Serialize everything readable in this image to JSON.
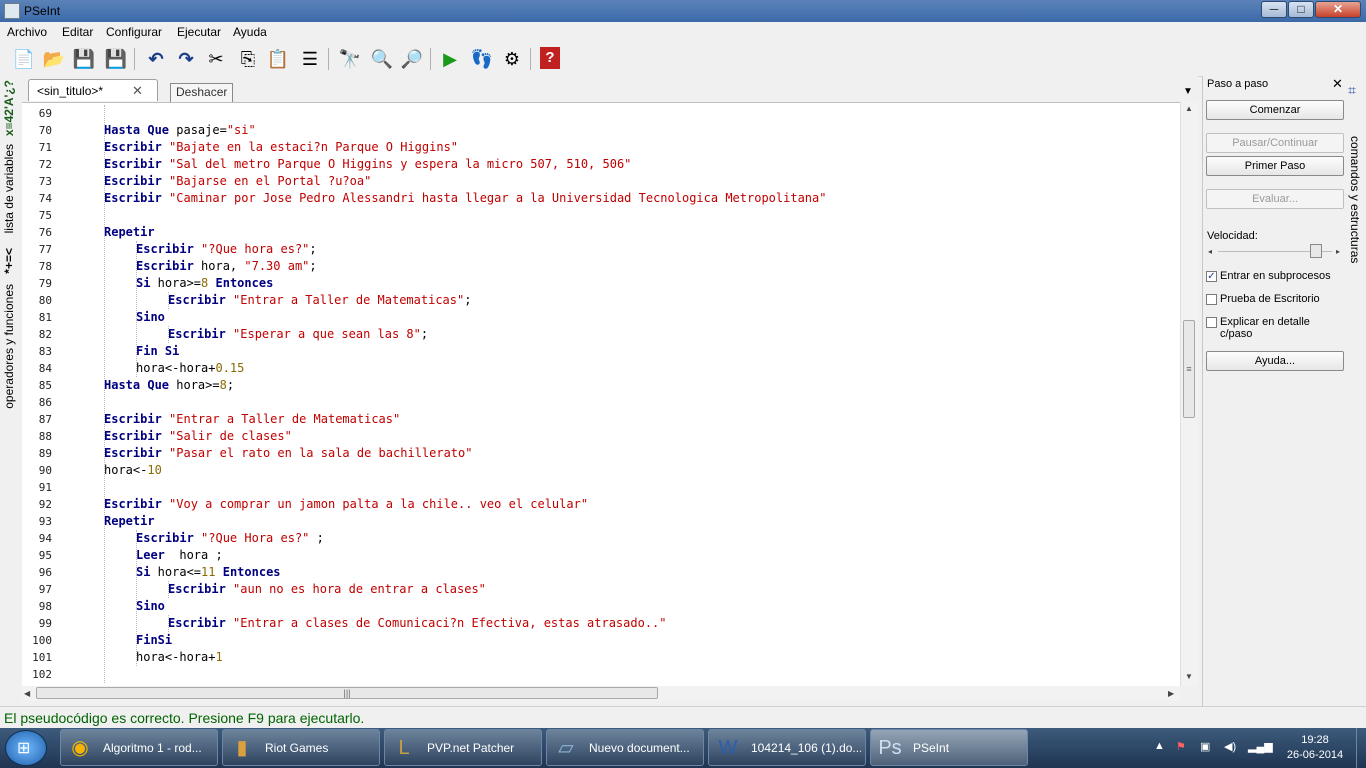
{
  "window": {
    "title": "PSeInt",
    "min": "─",
    "max": "□",
    "close": "✕"
  },
  "menu": [
    "Archivo",
    "Editar",
    "Configurar",
    "Ejecutar",
    "Ayuda"
  ],
  "toolbar_icons": [
    {
      "name": "new-file-icon",
      "glyph": "📄"
    },
    {
      "name": "open-file-icon",
      "glyph": "📂"
    },
    {
      "name": "save-icon",
      "glyph": "💾"
    },
    {
      "name": "save-as-icon",
      "glyph": "💾"
    },
    {
      "name": "undo-icon",
      "glyph": "↶"
    },
    {
      "name": "redo-icon",
      "glyph": "↷"
    },
    {
      "name": "cut-icon",
      "glyph": "✂"
    },
    {
      "name": "copy-icon",
      "glyph": "⎘"
    },
    {
      "name": "paste-icon",
      "glyph": "📋"
    },
    {
      "name": "indent-icon",
      "glyph": "☰"
    },
    {
      "name": "find-icon",
      "glyph": "🔭"
    },
    {
      "name": "find-previous-icon",
      "glyph": "🔍"
    },
    {
      "name": "find-next-icon",
      "glyph": "🔎"
    },
    {
      "name": "run-icon",
      "glyph": "▶"
    },
    {
      "name": "step-by-step-icon",
      "glyph": "👣"
    },
    {
      "name": "flowchart-icon",
      "glyph": "⚙"
    },
    {
      "name": "help-icon",
      "glyph": "?"
    }
  ],
  "left_panel": {
    "variables_label": "lista de variables",
    "variables_symbols": "*+=<",
    "operators_label": "operadores y funciones",
    "operators_symbols": "x≡42'A'¿?"
  },
  "tab": {
    "label": "<sin_titulo>*",
    "close": "✕"
  },
  "tooltip": "Deshacer",
  "code_lines": [
    {
      "n": "69",
      "indent": 0,
      "tokens": []
    },
    {
      "n": "70",
      "indent": 1,
      "tokens": [
        {
          "t": "Hasta Que",
          "c": "kw"
        },
        {
          "t": " pasaje=",
          "c": ""
        },
        {
          "t": "\"si\"",
          "c": "str"
        }
      ]
    },
    {
      "n": "71",
      "indent": 1,
      "tokens": [
        {
          "t": "Escribir",
          "c": "kw"
        },
        {
          "t": " ",
          "c": ""
        },
        {
          "t": "\"Bajate en la estaci?n Parque O Higgins\"",
          "c": "str"
        }
      ]
    },
    {
      "n": "72",
      "indent": 1,
      "tokens": [
        {
          "t": "Escribir",
          "c": "kw"
        },
        {
          "t": " ",
          "c": ""
        },
        {
          "t": "\"Sal del metro Parque O Higgins y espera la micro 507, 510, 506\"",
          "c": "str"
        }
      ]
    },
    {
      "n": "73",
      "indent": 1,
      "tokens": [
        {
          "t": "Escribir",
          "c": "kw"
        },
        {
          "t": " ",
          "c": ""
        },
        {
          "t": "\"Bajarse en el Portal ?u?oa\"",
          "c": "str"
        }
      ]
    },
    {
      "n": "74",
      "indent": 1,
      "tokens": [
        {
          "t": "Escribir",
          "c": "kw"
        },
        {
          "t": " ",
          "c": ""
        },
        {
          "t": "\"Caminar por Jose Pedro Alessandri hasta llegar a la Universidad Tecnologica Metropolitana\"",
          "c": "str"
        }
      ]
    },
    {
      "n": "75",
      "indent": 1,
      "tokens": []
    },
    {
      "n": "76",
      "indent": 1,
      "tokens": [
        {
          "t": "Repetir",
          "c": "kw"
        }
      ]
    },
    {
      "n": "77",
      "indent": 2,
      "tokens": [
        {
          "t": "Escribir",
          "c": "kw"
        },
        {
          "t": " ",
          "c": ""
        },
        {
          "t": "\"?Que hora es?\"",
          "c": "str"
        },
        {
          "t": ";",
          "c": ""
        }
      ]
    },
    {
      "n": "78",
      "indent": 2,
      "tokens": [
        {
          "t": "Escribir",
          "c": "kw"
        },
        {
          "t": " hora, ",
          "c": ""
        },
        {
          "t": "\"7.30 am\"",
          "c": "str"
        },
        {
          "t": ";",
          "c": ""
        }
      ]
    },
    {
      "n": "79",
      "indent": 2,
      "tokens": [
        {
          "t": "Si",
          "c": "kw"
        },
        {
          "t": " hora>=",
          "c": ""
        },
        {
          "t": "8",
          "c": "num"
        },
        {
          "t": " ",
          "c": ""
        },
        {
          "t": "Entonces",
          "c": "kw"
        }
      ]
    },
    {
      "n": "80",
      "indent": 3,
      "tokens": [
        {
          "t": "Escribir",
          "c": "kw"
        },
        {
          "t": " ",
          "c": ""
        },
        {
          "t": "\"Entrar a Taller de Matematicas\"",
          "c": "str"
        },
        {
          "t": ";",
          "c": ""
        }
      ]
    },
    {
      "n": "81",
      "indent": 2,
      "tokens": [
        {
          "t": "Sino",
          "c": "kw"
        }
      ]
    },
    {
      "n": "82",
      "indent": 3,
      "tokens": [
        {
          "t": "Escribir",
          "c": "kw"
        },
        {
          "t": " ",
          "c": ""
        },
        {
          "t": "\"Esperar a que sean las 8\"",
          "c": "str"
        },
        {
          "t": ";",
          "c": ""
        }
      ]
    },
    {
      "n": "83",
      "indent": 2,
      "tokens": [
        {
          "t": "Fin Si",
          "c": "kw"
        }
      ]
    },
    {
      "n": "84",
      "indent": 2,
      "tokens": [
        {
          "t": "hora<-hora+",
          "c": ""
        },
        {
          "t": "0.15",
          "c": "num"
        }
      ]
    },
    {
      "n": "85",
      "indent": 1,
      "tokens": [
        {
          "t": "Hasta Que",
          "c": "kw"
        },
        {
          "t": " hora>=",
          "c": ""
        },
        {
          "t": "8",
          "c": "num"
        },
        {
          "t": ";",
          "c": ""
        }
      ]
    },
    {
      "n": "86",
      "indent": 1,
      "tokens": []
    },
    {
      "n": "87",
      "indent": 1,
      "tokens": [
        {
          "t": "Escribir",
          "c": "kw"
        },
        {
          "t": " ",
          "c": ""
        },
        {
          "t": "\"Entrar a Taller de Matematicas\"",
          "c": "str"
        }
      ]
    },
    {
      "n": "88",
      "indent": 1,
      "tokens": [
        {
          "t": "Escribir",
          "c": "kw"
        },
        {
          "t": " ",
          "c": ""
        },
        {
          "t": "\"Salir de clases\"",
          "c": "str"
        }
      ]
    },
    {
      "n": "89",
      "indent": 1,
      "tokens": [
        {
          "t": "Escribir",
          "c": "kw"
        },
        {
          "t": " ",
          "c": ""
        },
        {
          "t": "\"Pasar el rato en la sala de bachillerato\"",
          "c": "str"
        }
      ]
    },
    {
      "n": "90",
      "indent": 1,
      "tokens": [
        {
          "t": "hora<-",
          "c": ""
        },
        {
          "t": "10",
          "c": "num"
        }
      ]
    },
    {
      "n": "91",
      "indent": 1,
      "tokens": []
    },
    {
      "n": "92",
      "indent": 1,
      "tokens": [
        {
          "t": "Escribir",
          "c": "kw"
        },
        {
          "t": " ",
          "c": ""
        },
        {
          "t": "\"Voy a comprar un jamon palta a la chile.. veo el celular\"",
          "c": "str"
        }
      ]
    },
    {
      "n": "93",
      "indent": 1,
      "tokens": [
        {
          "t": "Repetir",
          "c": "kw"
        }
      ]
    },
    {
      "n": "94",
      "indent": 2,
      "tokens": [
        {
          "t": "Escribir",
          "c": "kw"
        },
        {
          "t": " ",
          "c": ""
        },
        {
          "t": "\"?Que Hora es?\"",
          "c": "str"
        },
        {
          "t": " ;",
          "c": ""
        }
      ]
    },
    {
      "n": "95",
      "indent": 2,
      "tokens": [
        {
          "t": "Leer",
          "c": "kw"
        },
        {
          "t": "  hora ;",
          "c": ""
        }
      ]
    },
    {
      "n": "96",
      "indent": 2,
      "tokens": [
        {
          "t": "Si",
          "c": "kw"
        },
        {
          "t": " hora<=",
          "c": ""
        },
        {
          "t": "11",
          "c": "num"
        },
        {
          "t": " ",
          "c": ""
        },
        {
          "t": "Entonces",
          "c": "kw"
        }
      ]
    },
    {
      "n": "97",
      "indent": 3,
      "tokens": [
        {
          "t": "Escribir",
          "c": "kw"
        },
        {
          "t": " ",
          "c": ""
        },
        {
          "t": "\"aun no es hora de entrar a clases\"",
          "c": "str"
        }
      ]
    },
    {
      "n": "98",
      "indent": 2,
      "tokens": [
        {
          "t": "Sino",
          "c": "kw"
        }
      ]
    },
    {
      "n": "99",
      "indent": 3,
      "tokens": [
        {
          "t": "Escribir",
          "c": "kw"
        },
        {
          "t": " ",
          "c": ""
        },
        {
          "t": "\"Entrar a clases de Comunicaci?n Efectiva, estas atrasado..\"",
          "c": "str"
        }
      ]
    },
    {
      "n": "100",
      "indent": 2,
      "tokens": [
        {
          "t": "FinSi",
          "c": "kw"
        }
      ]
    },
    {
      "n": "101",
      "indent": 2,
      "tokens": [
        {
          "t": "hora<-hora+",
          "c": ""
        },
        {
          "t": "1",
          "c": "num"
        }
      ]
    },
    {
      "n": "102",
      "indent": 2,
      "tokens": []
    }
  ],
  "right_panel": {
    "title": "Paso a paso",
    "close": "✕",
    "btn_start": "Comenzar",
    "btn_pause": "Pausar/Continuar",
    "btn_first_step": "Primer Paso",
    "btn_evaluate": "Evaluar...",
    "speed_label": "Velocidad:",
    "speed_level": 0.9,
    "chk_subprocesos": {
      "label": "Entrar en subprocesos",
      "checked": true
    },
    "chk_escritorio": {
      "label": "Prueba de Escritorio",
      "checked": false
    },
    "chk_explicar": {
      "label": "Explicar en detalle c/paso",
      "checked": false
    },
    "btn_help": "Ayuda..."
  },
  "right_vertical_label": "comandos y estructuras",
  "status": "El pseudocódigo es correcto. Presione F9 para ejecutarlo.",
  "taskbar": {
    "tasks": [
      {
        "label": "Algoritmo 1 - rod...",
        "icon": "◉",
        "active": false
      },
      {
        "label": "Riot Games",
        "icon": "▮",
        "active": false
      },
      {
        "label": "PVP.net Patcher",
        "icon": "L",
        "active": false
      },
      {
        "label": "Nuevo document...",
        "icon": "▱",
        "active": false
      },
      {
        "label": "104214_106 (1).do...",
        "icon": "W",
        "active": false
      },
      {
        "label": "PSeInt",
        "icon": "Ps",
        "active": true
      }
    ],
    "time": "19:28",
    "date": "26-06-2014",
    "colors": {
      "status_text": "#006400",
      "keyword": "#000080",
      "string": "#c00000",
      "number": "#8a6a00"
    }
  }
}
